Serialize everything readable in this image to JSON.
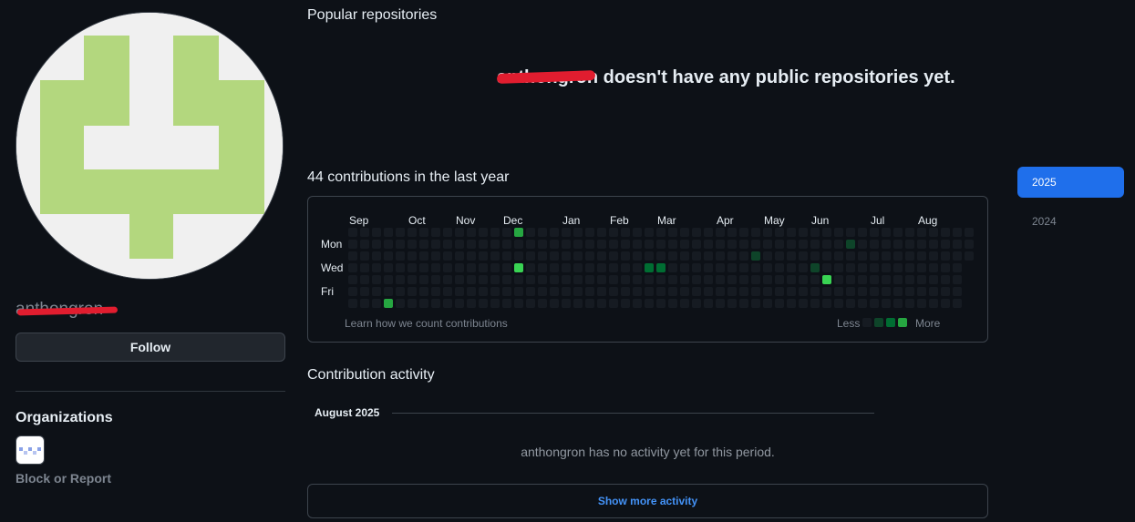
{
  "sidebar": {
    "username": "anthongron",
    "follow_label": "Follow",
    "organizations_heading": "Organizations",
    "block_report_label": "Block or Report"
  },
  "popular": {
    "heading": "Popular repositories",
    "empty_name": "anthongron",
    "empty_message": " doesn't have any public repositories yet."
  },
  "contributions": {
    "heading": "44 contributions in the last year",
    "months": [
      "Sep",
      "Oct",
      "Nov",
      "Dec",
      "Jan",
      "Feb",
      "Mar",
      "Apr",
      "May",
      "Jun",
      "Jul",
      "Aug"
    ],
    "days": [
      "Mon",
      "Wed",
      "Fri"
    ],
    "learn_link": "Learn how we count contributions",
    "legend_less": "Less",
    "legend_more": "More",
    "level_colors": [
      "#161b22",
      "#0e4429",
      "#006d32",
      "#26a641",
      "#39d353"
    ],
    "active_cells": [
      {
        "week": 3,
        "day": 6,
        "level": 3
      },
      {
        "week": 14,
        "day": 0,
        "level": 3
      },
      {
        "week": 14,
        "day": 3,
        "level": 4
      },
      {
        "week": 25,
        "day": 3,
        "level": 2
      },
      {
        "week": 26,
        "day": 3,
        "level": 2
      },
      {
        "week": 34,
        "day": 2,
        "level": 1
      },
      {
        "week": 39,
        "day": 3,
        "level": 1
      },
      {
        "week": 40,
        "day": 4,
        "level": 4
      },
      {
        "week": 42,
        "day": 1,
        "level": 1
      }
    ]
  },
  "years": [
    "2025",
    "2024"
  ],
  "activity": {
    "heading": "Contribution activity",
    "month": "August 2025",
    "empty": "anthongron has no activity yet for this period.",
    "show_more": "Show more activity"
  }
}
